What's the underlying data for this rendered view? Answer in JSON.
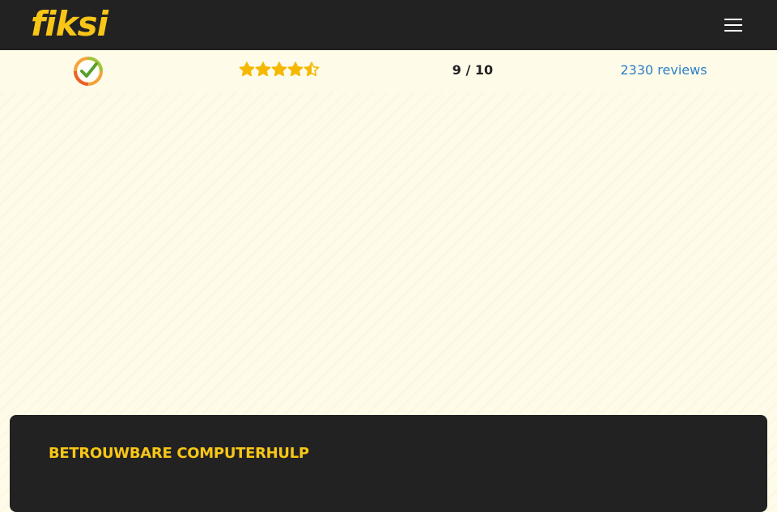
{
  "header": {
    "logo_text": "fiksi",
    "menu_icon": "hamburger-menu-icon",
    "background_color": "#222222",
    "brand_color": "#f8c617"
  },
  "rating": {
    "seal_icon": "checkmark-seal-icon",
    "stars": 4.5,
    "stars_max": 5,
    "score": "9 / 10",
    "reviews": "2330 reviews",
    "star_color": "#f5b800",
    "link_color": "#2a7fc9"
  },
  "section": {
    "title": "BETROUWBARE COMPUTERHULP",
    "background_color": "#222222"
  }
}
